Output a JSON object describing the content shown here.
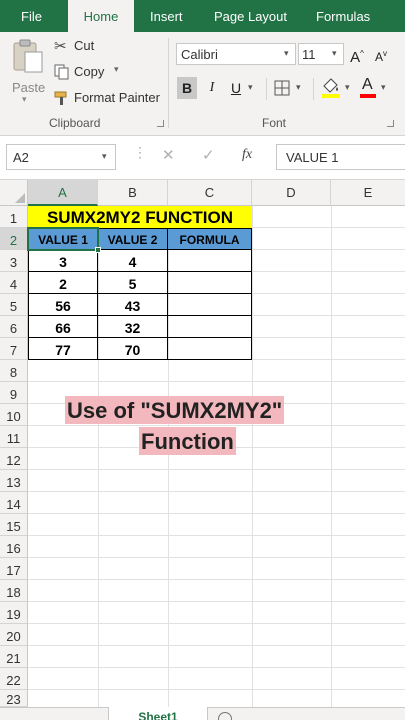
{
  "tabs": [
    "File",
    "Home",
    "Insert",
    "Page Layout",
    "Formulas"
  ],
  "clipboard": {
    "paste": "Paste",
    "cut": "Cut",
    "copy": "Copy",
    "format_painter": "Format Painter",
    "group_label": "Clipboard"
  },
  "font": {
    "name": "Calibri",
    "size": "11",
    "bold": "B",
    "italic": "I",
    "underline": "U",
    "grow": "A",
    "shrink": "A",
    "font_color_letter": "A",
    "group_label": "Font",
    "fill_color": "#ffff00",
    "font_color": "#ff0000"
  },
  "formula_bar": {
    "name_box": "A2",
    "fx": "fx",
    "content": "VALUE 1"
  },
  "columns": [
    "A",
    "B",
    "C",
    "D",
    "E"
  ],
  "rows": [
    "1",
    "2",
    "3",
    "4",
    "5",
    "6",
    "7",
    "8",
    "9",
    "10",
    "11",
    "12",
    "13",
    "14",
    "15",
    "16",
    "17",
    "18",
    "19",
    "20",
    "21",
    "22",
    "23"
  ],
  "sheet": {
    "title": "SUMX2MY2 FUNCTION",
    "headers": [
      "VALUE 1",
      "VALUE 2",
      "FORMULA"
    ],
    "data": [
      [
        "3",
        "4",
        ""
      ],
      [
        "2",
        "5",
        ""
      ],
      [
        "56",
        "43",
        ""
      ],
      [
        "66",
        "32",
        ""
      ],
      [
        "77",
        "70",
        ""
      ]
    ]
  },
  "overlay": {
    "line1": "Use of \"SUMX2MY2\"",
    "line2": "Function"
  },
  "sheet_tab": "Sheet1",
  "colors": {
    "excel_green": "#217346",
    "title_fill": "#ffff00",
    "header_fill": "#5b9bd5",
    "overlay_fill": "#f2b8bd"
  }
}
